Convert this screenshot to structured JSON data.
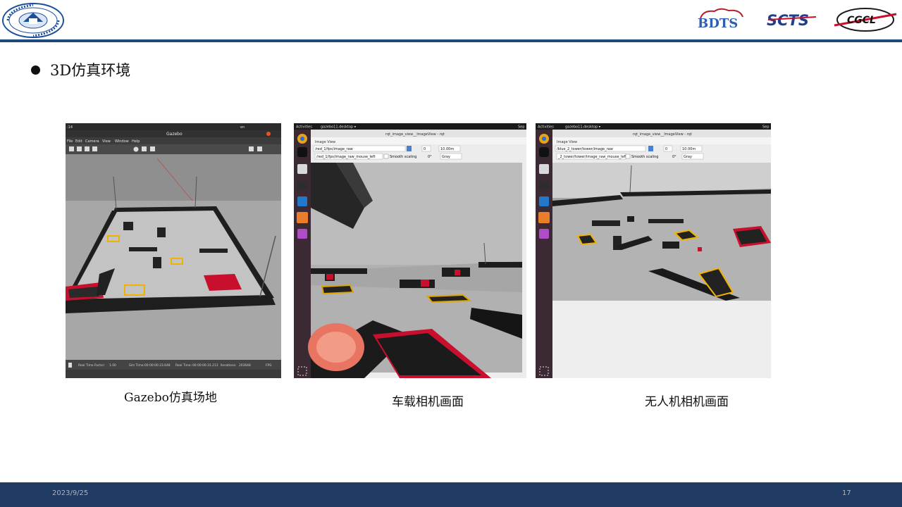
{
  "header": {
    "logo_left": "university-seal",
    "logos_right": [
      "BDTS",
      "SCTS",
      "CGCL"
    ]
  },
  "bullet": {
    "text": "3D仿真环境"
  },
  "screenshots": [
    {
      "caption": "Gazebo仿真场地",
      "window_title": "Gazebo",
      "clock": ":14",
      "locale": "en",
      "menu": [
        "File",
        "Edit",
        "Camera",
        "View",
        "Window",
        "Help"
      ],
      "status": {
        "real_time_factor_label": "Real Time Factor:",
        "real_time_factor": "1.00",
        "sim_time_label": "Sim Time:",
        "sim_time": "00:00:00:23.648",
        "real_time_label": "Real Time:",
        "real_time": "00:00:00:31.213",
        "iterations_label": "Iterations:",
        "iterations": "203648",
        "fps_label": "FPS:"
      }
    },
    {
      "caption": "车载相机画面",
      "activities": "Activities",
      "app_menu": "gazebo11.desktop ▾",
      "window_title": "rqt_image_view__ImageView - rqt",
      "clock": "Sep",
      "panel_title": "Image View",
      "topic": "/red_1/fps/image_raw",
      "mouse_topic": "/red_1/fps/image_raw_mouse_left",
      "smooth_label": "Smooth scaling",
      "min_value": "0",
      "max_value": "10.00m",
      "rotation": "0°",
      "color_mode": "Gray"
    },
    {
      "caption": "无人机相机画面",
      "activities": "Activities",
      "app_menu": "gazebo11.desktop ▾",
      "window_title": "rqt_image_view__ImageView - rqt",
      "clock": "Sep",
      "panel_title": "Image View",
      "topic": "/blue_2_tower/tower/image_raw",
      "mouse_topic": "_2_tower/tower/image_raw_mouse_left",
      "smooth_label": "Smooth scaling",
      "min_value": "0",
      "max_value": "10.00m",
      "rotation": "0°",
      "color_mode": "Gray"
    }
  ],
  "footer": {
    "date": "2023/9/25",
    "page": "17"
  }
}
